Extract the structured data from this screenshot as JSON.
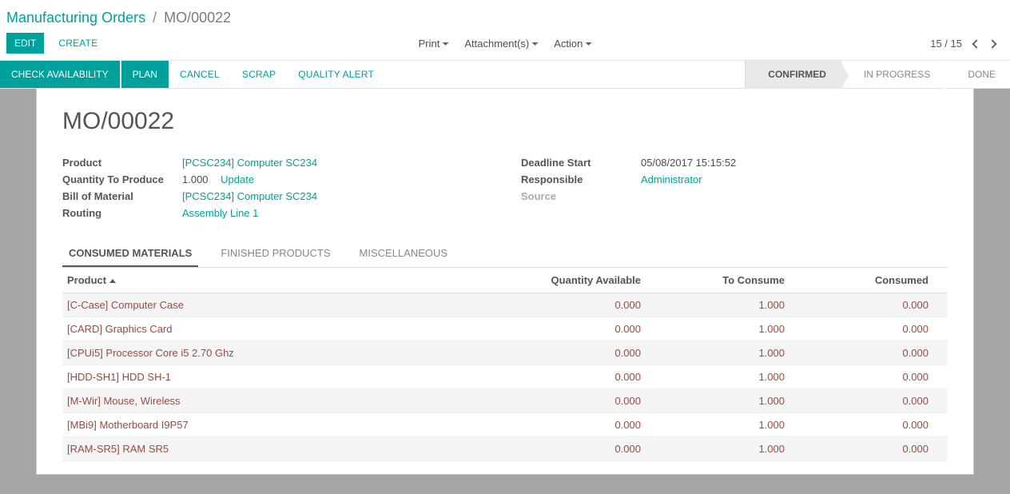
{
  "breadcrumb": {
    "root": "Manufacturing Orders",
    "current": "MO/00022"
  },
  "controls": {
    "edit": "EDIT",
    "create": "CREATE",
    "print": "Print",
    "attachments": "Attachment(s)",
    "action": "Action",
    "pager": "15 / 15"
  },
  "actionbar": {
    "check_availability": "CHECK AVAILABILITY",
    "plan": "PLAN",
    "cancel": "CANCEL",
    "scrap": "SCRAP",
    "quality_alert": "QUALITY ALERT"
  },
  "status": {
    "confirmed": "CONFIRMED",
    "in_progress": "IN PROGRESS",
    "done": "DONE"
  },
  "record": {
    "title": "MO/00022",
    "labels": {
      "product": "Product",
      "qty_to_produce": "Quantity To Produce",
      "bom": "Bill of Material",
      "routing": "Routing",
      "deadline": "Deadline Start",
      "responsible": "Responsible",
      "source": "Source"
    },
    "product": "[PCSC234] Computer SC234",
    "qty": "1.000",
    "update": "Update",
    "bom": "[PCSC234] Computer SC234",
    "routing": "Assembly Line 1",
    "deadline": "05/08/2017 15:15:52",
    "responsible": "Administrator",
    "source": ""
  },
  "tabs": {
    "consumed": "CONSUMED MATERIALS",
    "finished": "FINISHED PRODUCTS",
    "misc": "MISCELLANEOUS"
  },
  "table": {
    "headers": {
      "product": "Product",
      "qty_available": "Quantity Available",
      "to_consume": "To Consume",
      "consumed": "Consumed"
    },
    "rows": [
      {
        "product": "[C-Case] Computer Case",
        "qty_available": "0.000",
        "to_consume": "1.000",
        "consumed": "0.000"
      },
      {
        "product": "[CARD] Graphics Card",
        "qty_available": "0.000",
        "to_consume": "1.000",
        "consumed": "0.000"
      },
      {
        "product": "[CPUi5] Processor Core i5 2.70 Ghz",
        "qty_available": "0.000",
        "to_consume": "1.000",
        "consumed": "0.000"
      },
      {
        "product": "[HDD-SH1] HDD SH-1",
        "qty_available": "0.000",
        "to_consume": "1.000",
        "consumed": "0.000"
      },
      {
        "product": "[M-Wir] Mouse, Wireless",
        "qty_available": "0.000",
        "to_consume": "1.000",
        "consumed": "0.000"
      },
      {
        "product": "[MBi9] Motherboard I9P57",
        "qty_available": "0.000",
        "to_consume": "1.000",
        "consumed": "0.000"
      },
      {
        "product": "[RAM-SR5] RAM SR5",
        "qty_available": "0.000",
        "to_consume": "1.000",
        "consumed": "0.000"
      }
    ]
  }
}
